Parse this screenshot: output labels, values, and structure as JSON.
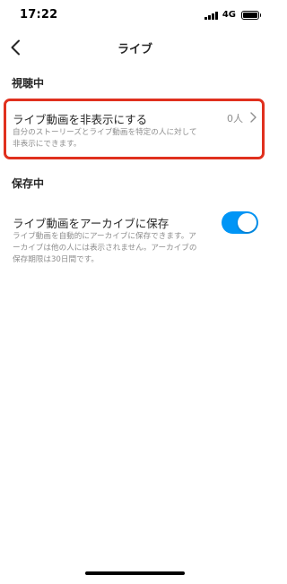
{
  "status_bar": {
    "time": "17:22",
    "network": "4G",
    "icons": [
      "signal-icon",
      "battery-icon"
    ]
  },
  "nav": {
    "title": "ライブ",
    "back_icon": "chevron-left-icon"
  },
  "sections": {
    "viewing": {
      "header": "視聴中",
      "hide_live": {
        "title": "ライブ動画を非表示にする",
        "value": "0人",
        "description_line1": "自分のストーリーズとライブ動画を特定の人に対して",
        "description_line2": "非表示にできます。",
        "icon": "chevron-right-icon"
      }
    },
    "saving": {
      "header": "保存中",
      "archive": {
        "title": "ライブ動画をアーカイブに保存",
        "description_line1": "ライブ動画を自動的にアーカイブに保存できます。ア",
        "description_line2": "ーカイブは他の人には表示されません。アーカイブの",
        "description_line3": "保存期限は30日間です。",
        "toggle_on": true
      }
    }
  },
  "colors": {
    "accent": "#0095f6",
    "highlight": "#e0301e",
    "secondary_text": "#8e8e8e",
    "primary_text": "#262626"
  }
}
